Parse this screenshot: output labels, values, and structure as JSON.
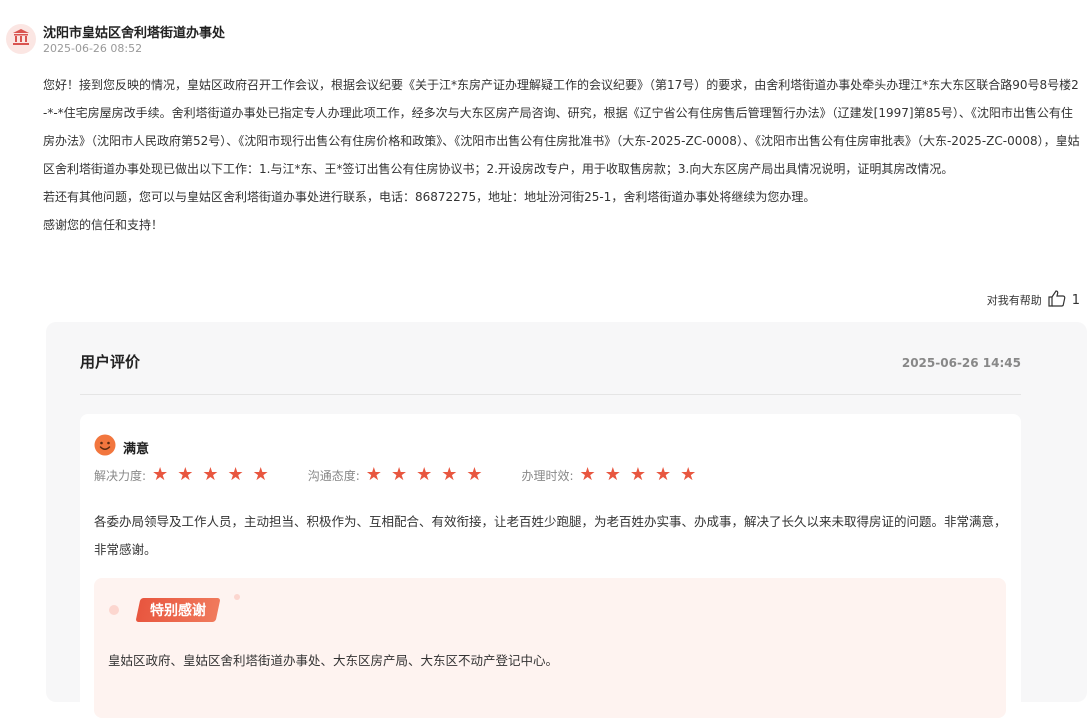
{
  "header": {
    "org_name": "沈阳市皇姑区舍利塔街道办事处",
    "post_time": "2025-06-26 08:52",
    "avatar_icon": "government-building-icon"
  },
  "reply": {
    "text": "您好！接到您反映的情况，皇姑区政府召开工作会议，根据会议纪要《关于江*东房产证办理解疑工作的会议纪要》（第17号）的要求，由舍利塔街道办事处牵头办理江*东大东区联合路90号8号楼2-*-*住宅房屋房改手续。舍利塔街道办事处已指定专人办理此项工作，经多次与大东区房产局咨询、研究，根据《辽宁省公有住房售后管理暂行办法》（辽建发[1997]第85号）、《沈阳市出售公有住房办法》（沈阳市人民政府第52号）、《沈阳市现行出售公有住房价格和政策》、《沈阳市出售公有住房批准书》（大东-2025-ZC-0008）、《沈阳市出售公有住房审批表》（大东-2025-ZC-0008），皇姑区舍利塔街道办事处现已做出以下工作：1.与江*东、王*签订出售公有住房协议书；2.开设房改专户，用于收取售房款；3.向大东区房产局出具情况说明，证明其房改情况。\n若还有其他问题，您可以与皇姑区舍利塔街道办事处进行联系，电话：86872275，地址：地址汾河街25-1，舍利塔街道办事处将继续为您办理。\n感谢您的信任和支持！"
  },
  "helpful": {
    "label": "对我有帮助",
    "count": "1",
    "icon": "thumbs-up-icon"
  },
  "evaluation": {
    "title": "用户评价",
    "time": "2025-06-26 14:45",
    "mood_label": "满意",
    "mood_icon": "smile-face-icon",
    "ratings": [
      {
        "label": "解决力度:",
        "stars": 5
      },
      {
        "label": "沟通态度:",
        "stars": 5
      },
      {
        "label": "办理时效:",
        "stars": 5
      }
    ],
    "comment": "各委办局领导及工作人员，主动担当、积极作为、互相配合、有效衔接，让老百姓少跑腿，为老百姓办实事、办成事，解决了长久以来未取得房证的问题。非常满意，非常感谢。",
    "thanks_badge": "特别感谢",
    "thanks_text": "皇姑区政府、皇姑区舍利塔街道办事处、大东区房产局、大东区不动产登记中心。"
  },
  "colors": {
    "accent": "#e8563f",
    "star": "#e8563f",
    "card_bg": "#f7f7f8",
    "thanks_bg": "#fef3f0"
  }
}
